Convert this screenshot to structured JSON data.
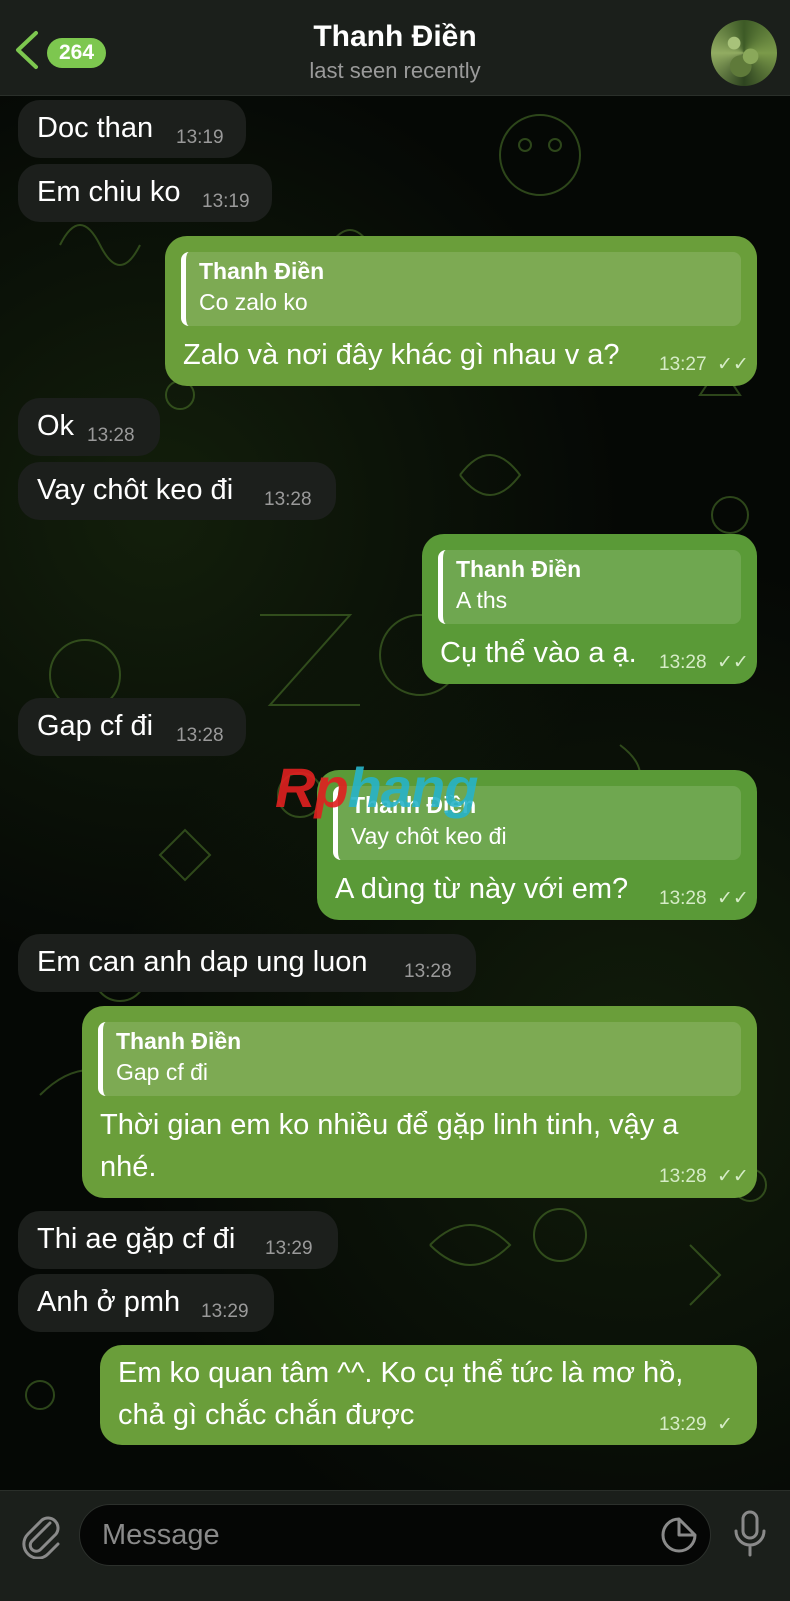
{
  "header": {
    "back_badge": "264",
    "title": "Thanh Điền",
    "subtitle": "last seen recently"
  },
  "messages": [
    {
      "dir": "in",
      "text": "Doc than",
      "time": "13:19"
    },
    {
      "dir": "in",
      "text": "Em chiu ko",
      "time": "13:19"
    },
    {
      "dir": "out",
      "reply_name": "Thanh Điền",
      "reply_text": "Co zalo ko",
      "text": "Zalo và nơi đây khác gì nhau v a?",
      "time": "13:27",
      "status": "read"
    },
    {
      "dir": "in",
      "text": "Ok",
      "time": "13:28"
    },
    {
      "dir": "in",
      "text": "Vay chôt keo đi",
      "time": "13:28"
    },
    {
      "dir": "out",
      "reply_name": "Thanh Điền",
      "reply_text": "A ths",
      "text": "Cụ thể vào a ạ.",
      "time": "13:28",
      "status": "read"
    },
    {
      "dir": "in",
      "text": "Gap cf đi",
      "time": "13:28"
    },
    {
      "dir": "out",
      "reply_name": "Thanh Điền",
      "reply_text": "Vay chôt keo đi",
      "text": "A dùng từ này với em?",
      "time": "13:28",
      "status": "read"
    },
    {
      "dir": "in",
      "text": "Em can anh dap ung luon",
      "time": "13:28"
    },
    {
      "dir": "out",
      "reply_name": "Thanh Điền",
      "reply_text": "Gap cf đi",
      "text_line1": "Thời gian em ko nhiều để gặp linh tinh, vậy a",
      "text_line2": "nhé.",
      "time": "13:28",
      "status": "read"
    },
    {
      "dir": "in",
      "text": "Thi ae gặp cf đi",
      "time": "13:29"
    },
    {
      "dir": "in",
      "text": "Anh ở pmh",
      "time": "13:29"
    },
    {
      "dir": "out",
      "text_line1": "Em ko quan tâm ^^. Ko cụ thể tức là mơ hồ,",
      "text_line2": "chả gì chắc chắn được",
      "time": "13:29",
      "status": "sent"
    }
  ],
  "watermark": {
    "part1": "Rp",
    "part2": "hang"
  },
  "composer": {
    "placeholder": "Message"
  },
  "icons": {
    "back": "chevron-left-icon",
    "attach": "paperclip-icon",
    "sticker": "sticker-icon",
    "mic": "microphone-icon",
    "read_checks": "double-check-icon",
    "sent_check": "single-check-icon"
  },
  "colors": {
    "accent": "#7dc74f",
    "outgoing_bubble": "#5a9a37",
    "incoming_bubble": "#1c1f1c",
    "background": "#000000"
  }
}
